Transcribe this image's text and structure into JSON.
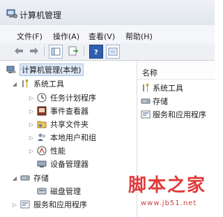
{
  "window": {
    "title": "计算机管理"
  },
  "menu": [
    {
      "label": "文件(F)"
    },
    {
      "label": "操作(A)"
    },
    {
      "label": "查看(V)"
    },
    {
      "label": "帮助(H)"
    }
  ],
  "toolbar": {
    "buttons": [
      "back-icon",
      "forward-icon",
      "show-hide-tree-icon",
      "export-icon",
      "help-icon",
      "properties-icon"
    ]
  },
  "tree": {
    "root": "计算机管理(本地)",
    "items": [
      {
        "label": "系统工具",
        "icon": "tools-icon"
      },
      {
        "label": "任务计划程序",
        "icon": "clock-icon"
      },
      {
        "label": "事件查看器",
        "icon": "event-viewer-icon"
      },
      {
        "label": "共享文件夹",
        "icon": "shared-folder-icon"
      },
      {
        "label": "本地用户和组",
        "icon": "users-icon"
      },
      {
        "label": "性能",
        "icon": "performance-icon"
      },
      {
        "label": "设备管理器",
        "icon": "device-manager-icon"
      },
      {
        "label": "存储",
        "icon": "storage-icon"
      },
      {
        "label": "磁盘管理",
        "icon": "disk-icon"
      },
      {
        "label": "服务和应用程序",
        "icon": "services-icon"
      }
    ]
  },
  "list": {
    "header": "名称",
    "items": [
      {
        "label": "系统工具",
        "icon": "tools-icon"
      },
      {
        "label": "存储",
        "icon": "storage-icon"
      },
      {
        "label": "服务和应用程序",
        "icon": "services-icon"
      }
    ]
  },
  "watermark": {
    "text": "脚本之家",
    "url": "www.jb51.net"
  }
}
